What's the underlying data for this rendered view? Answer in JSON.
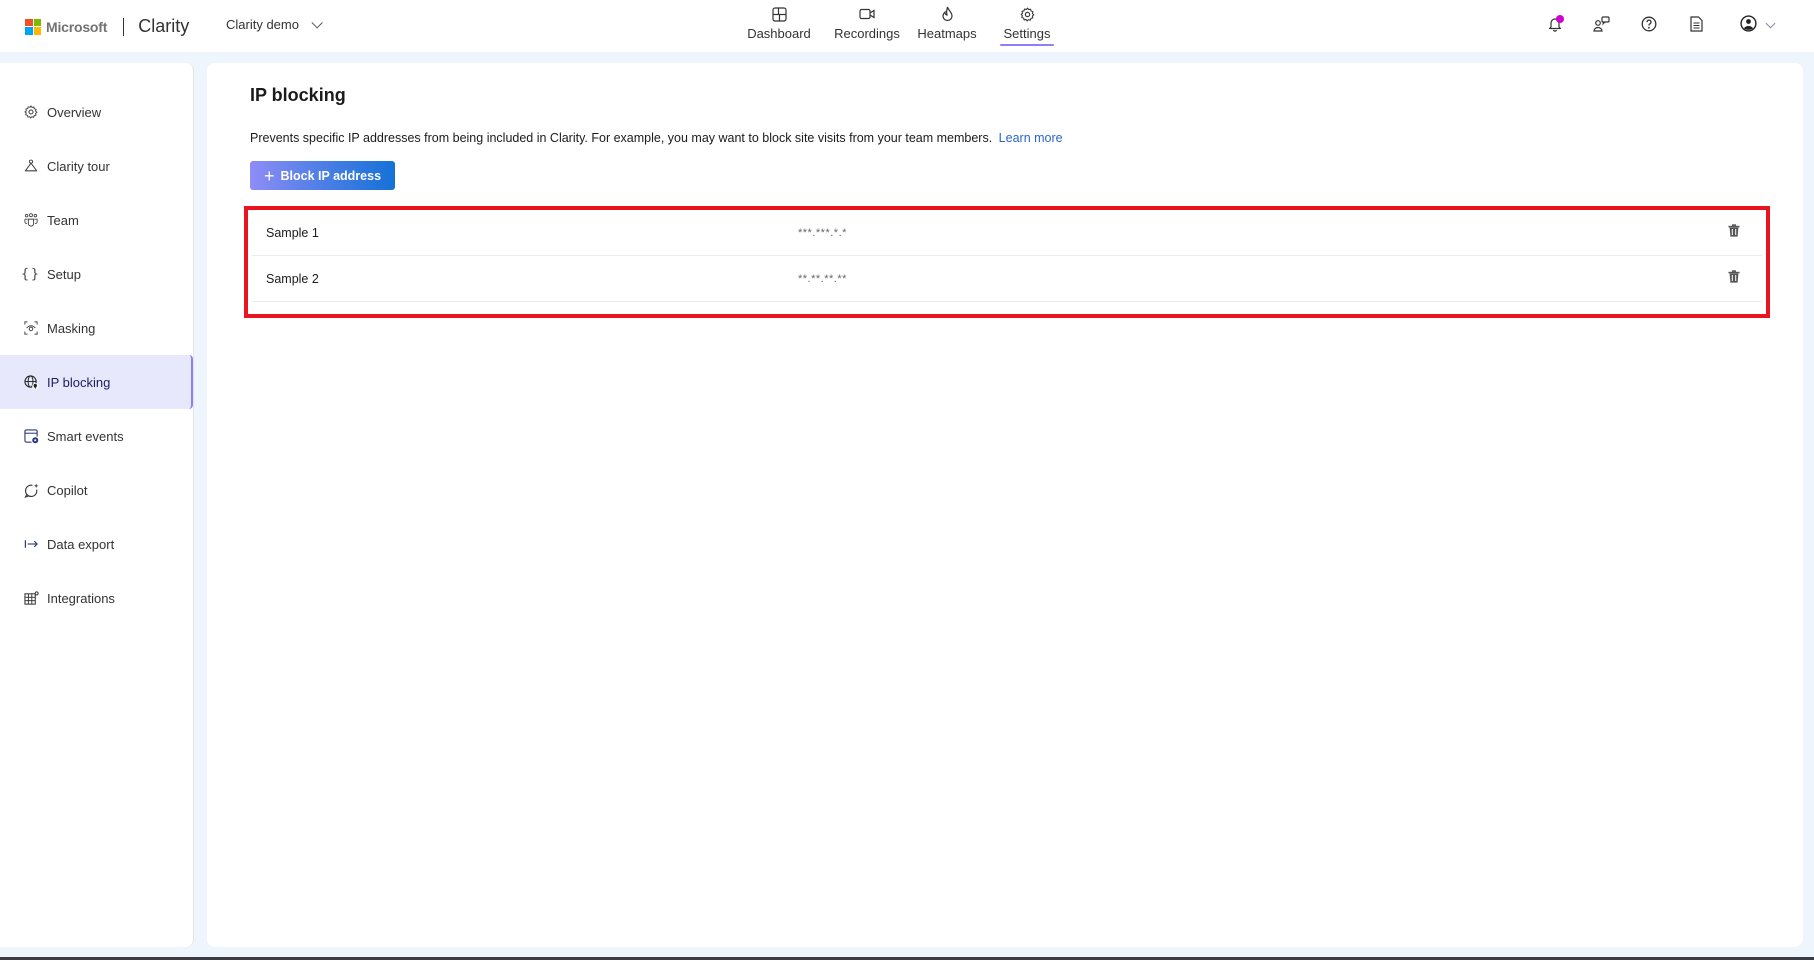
{
  "header": {
    "brand": "Microsoft",
    "app_name": "Clarity",
    "project": "Clarity demo",
    "nav": [
      {
        "label": "Dashboard",
        "icon": "dashboard-icon"
      },
      {
        "label": "Recordings",
        "icon": "video-camera-icon"
      },
      {
        "label": "Heatmaps",
        "icon": "flame-icon"
      },
      {
        "label": "Settings",
        "icon": "gear-icon",
        "active": true
      }
    ],
    "actions": [
      {
        "name": "notifications",
        "icon": "bell-icon",
        "has_badge": true
      },
      {
        "name": "feedback",
        "icon": "people-chat-icon"
      },
      {
        "name": "help",
        "icon": "help-circle-icon"
      },
      {
        "name": "documentation",
        "icon": "document-icon"
      },
      {
        "name": "account",
        "icon": "account-icon"
      }
    ]
  },
  "sidebar": {
    "items": [
      {
        "label": "Overview",
        "icon": "gear-icon"
      },
      {
        "label": "Clarity tour",
        "icon": "tour-hanger-icon"
      },
      {
        "label": "Team",
        "icon": "team-icon"
      },
      {
        "label": "Setup",
        "icon": "braces-icon"
      },
      {
        "label": "Masking",
        "icon": "eye-scan-icon"
      },
      {
        "label": "IP blocking",
        "icon": "globe-lock-icon",
        "active": true
      },
      {
        "label": "Smart events",
        "icon": "calendar-gear-icon"
      },
      {
        "label": "Copilot",
        "icon": "copilot-sparkle-icon"
      },
      {
        "label": "Data export",
        "icon": "export-arrow-icon"
      },
      {
        "label": "Integrations",
        "icon": "grid-plug-icon"
      }
    ]
  },
  "main": {
    "title": "IP blocking",
    "description": "Prevents specific IP addresses from being included in Clarity. For example, you may want to block site visits from your team members.",
    "learn_more": "Learn more",
    "block_button": "Block IP address",
    "rows": [
      {
        "name": "Sample 1",
        "ip": "***.***.*.*"
      },
      {
        "name": "Sample 2",
        "ip": "**.**.**.**"
      }
    ]
  },
  "colors": {
    "accent": "#8b80f9",
    "active_bg": "#e8e8fc",
    "link": "#2b64cf",
    "highlight_box": "#e8141f",
    "notification_dot": "#d100d1"
  }
}
